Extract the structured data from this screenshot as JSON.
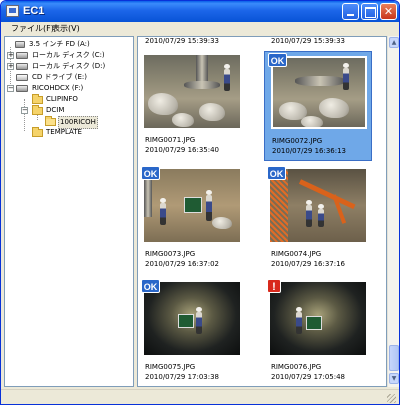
{
  "window": {
    "title": "EC1"
  },
  "menu": [
    {
      "label": "ファイル(F)"
    },
    {
      "label": "表示(V)"
    }
  ],
  "tree": {
    "items": [
      {
        "label": "3.5 インチ FD (A:)",
        "icon": "floppy-drive-icon",
        "expander": ""
      },
      {
        "label": "ローカル ディスク (C:)",
        "icon": "hard-drive-icon",
        "expander": "+"
      },
      {
        "label": "ローカル ディスク (D:)",
        "icon": "hard-drive-icon",
        "expander": "+"
      },
      {
        "label": "CD ドライブ (E:)",
        "icon": "cd-drive-icon",
        "expander": ""
      },
      {
        "label": "RICOHDCX (F:)",
        "icon": "removable-drive-icon",
        "expander": "−"
      },
      {
        "label": "CLIPINFO",
        "icon": "folder-icon",
        "expander": ""
      },
      {
        "label": "DCIM",
        "icon": "folder-icon",
        "expander": "−"
      },
      {
        "label": "100RICOH",
        "icon": "folder-open-icon",
        "expander": "",
        "selected": true
      },
      {
        "label": "TEMPLATE",
        "icon": "folder-icon",
        "expander": ""
      }
    ]
  },
  "grid": {
    "top_partial": [
      {
        "date": "2010/07/29  15:39:33"
      },
      {
        "date": "2010/07/29  15:39:33"
      }
    ],
    "items": [
      {
        "filename": "RIMG0071.JPG",
        "date": "2010/07/29  16:35:40",
        "badge": "",
        "selected": false,
        "scene": "construction-site"
      },
      {
        "filename": "RIMG0072.JPG",
        "date": "2010/07/29  16:36:13",
        "badge": "OK",
        "selected": true,
        "scene": "construction-site"
      },
      {
        "filename": "RIMG0073.JPG",
        "date": "2010/07/29  16:37:02",
        "badge": "OK",
        "selected": false,
        "scene": "construction-site"
      },
      {
        "filename": "RIMG0074.JPG",
        "date": "2010/07/29  16:37:16",
        "badge": "OK",
        "selected": false,
        "scene": "excavator-site"
      },
      {
        "filename": "RIMG0075.JPG",
        "date": "2010/07/29  17:03:38",
        "badge": "OK",
        "selected": false,
        "scene": "tunnel"
      },
      {
        "filename": "RIMG0076.JPG",
        "date": "2010/07/29  17:05:48",
        "badge": "!",
        "selected": false,
        "scene": "tunnel"
      }
    ]
  },
  "colors": {
    "ok_badge": "#2a67c9",
    "warning_badge": "#d8291c",
    "selection": "#6fa8e8",
    "titlebar": "#0853d6"
  }
}
